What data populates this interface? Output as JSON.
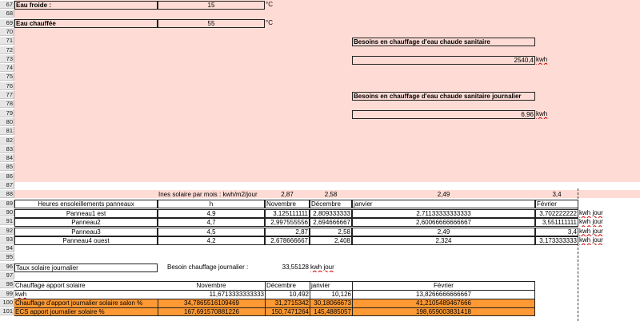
{
  "row_numbers": [
    "67",
    "68",
    "69",
    "70",
    "71",
    "72",
    "73",
    "74",
    "75",
    "76",
    "77",
    "78",
    "79",
    "80",
    "81",
    "82",
    "83",
    "84",
    "85",
    "86",
    "87",
    "88",
    "89",
    "90",
    "91",
    "92",
    "93",
    "94",
    "95",
    "96",
    "97",
    "98",
    "99",
    "100",
    "101"
  ],
  "water": {
    "cold_label": "Eau froide :",
    "cold_value": "15",
    "cold_unit": "°C",
    "hot_label": "Eau chauffée",
    "hot_value": "55",
    "hot_unit": "°C"
  },
  "needs": {
    "total_title": "Besoins en chauffage d'eau chaude sanitaire",
    "total_value": "2540,4",
    "total_unit": "kwh",
    "daily_title": "Besoins en chauffage d'eau chaude sanitaire journalier",
    "daily_value": "6,96",
    "daily_unit": "kwh"
  },
  "insolation": {
    "label": "Ines solaire par mois : kwh/m2/jour",
    "values": [
      "2,87",
      "2,58",
      "2,49",
      "3,4"
    ]
  },
  "panels": {
    "header_label": "Heures ensoleillements panneaux",
    "header_unit": "h",
    "months": [
      "Novembre",
      "Décembre",
      "janvier",
      "Février"
    ],
    "unit": "kwh jour",
    "rows": [
      {
        "name": "Panneau1 est",
        "h": "4,9",
        "values": [
          "3,125111111",
          "2,809333333",
          "2,71133333333333",
          "3,702222222"
        ]
      },
      {
        "name": "Panneau2",
        "h": "4,7",
        "values": [
          "2,997555556",
          "2,694666667",
          "2,60066666666667",
          "3,551111111"
        ]
      },
      {
        "name": "Panneau3",
        "h": "4,5",
        "values": [
          "2,87",
          "2,58",
          "2,49",
          "3,4"
        ]
      },
      {
        "name": "Panneau4 ouest",
        "h": "4,2",
        "values": [
          "2,678666667",
          "2,408",
          "2,324",
          "3,173333333"
        ]
      }
    ]
  },
  "solar_rate": {
    "label": "Taux solaire journalier",
    "need_label": "Besoin chauffage journalier :",
    "need_value": "33,55128",
    "need_unit": "kwh jour"
  },
  "supply": {
    "header_label": "Chauffage apport solaire",
    "months": [
      "Novembre",
      "Décembre",
      "janvier",
      "Février"
    ],
    "unit_label": "kwh",
    "kwh_values": [
      "11,6713333333333",
      "10,492",
      "10,126",
      "13,8266666666667"
    ],
    "salon_label": "Chauffage d'apport journalier solaire salon %",
    "salon_values": [
      "34,7865516109469",
      "31,2715342",
      "30,18066673",
      "41,2105489467666"
    ],
    "ecs_label": "ECS apport journalier solaire %",
    "ecs_values": [
      "167,691570881226",
      "150,7471264",
      "145,4885057",
      "198,659003831418"
    ]
  },
  "colors": {
    "band": "#fedcd5",
    "highlight": "#ff9933"
  }
}
